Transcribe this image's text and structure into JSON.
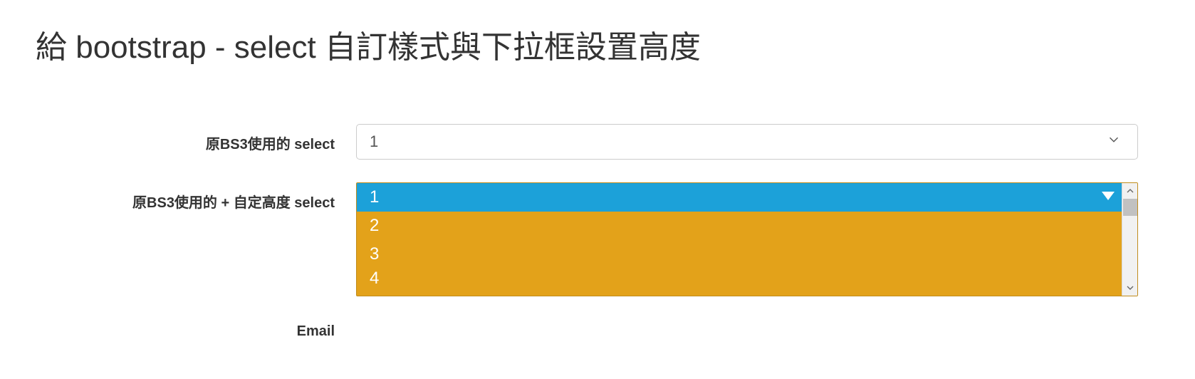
{
  "heading": "給 bootstrap - select 自訂樣式與下拉框設置高度",
  "rows": {
    "row1": {
      "label": "原BS3使用的 select",
      "selected": "1"
    },
    "row2": {
      "label": "原BS3使用的 + 自定高度 select",
      "options": {
        "o1": "1",
        "o2": "2",
        "o3": "3",
        "o4": "4"
      },
      "selected_index": 0
    },
    "row3": {
      "label": "Email"
    }
  },
  "colors": {
    "dropdown_bg": "#e3a21a",
    "dropdown_selected": "#1ca1d9",
    "dropdown_text": "#ffffff"
  }
}
